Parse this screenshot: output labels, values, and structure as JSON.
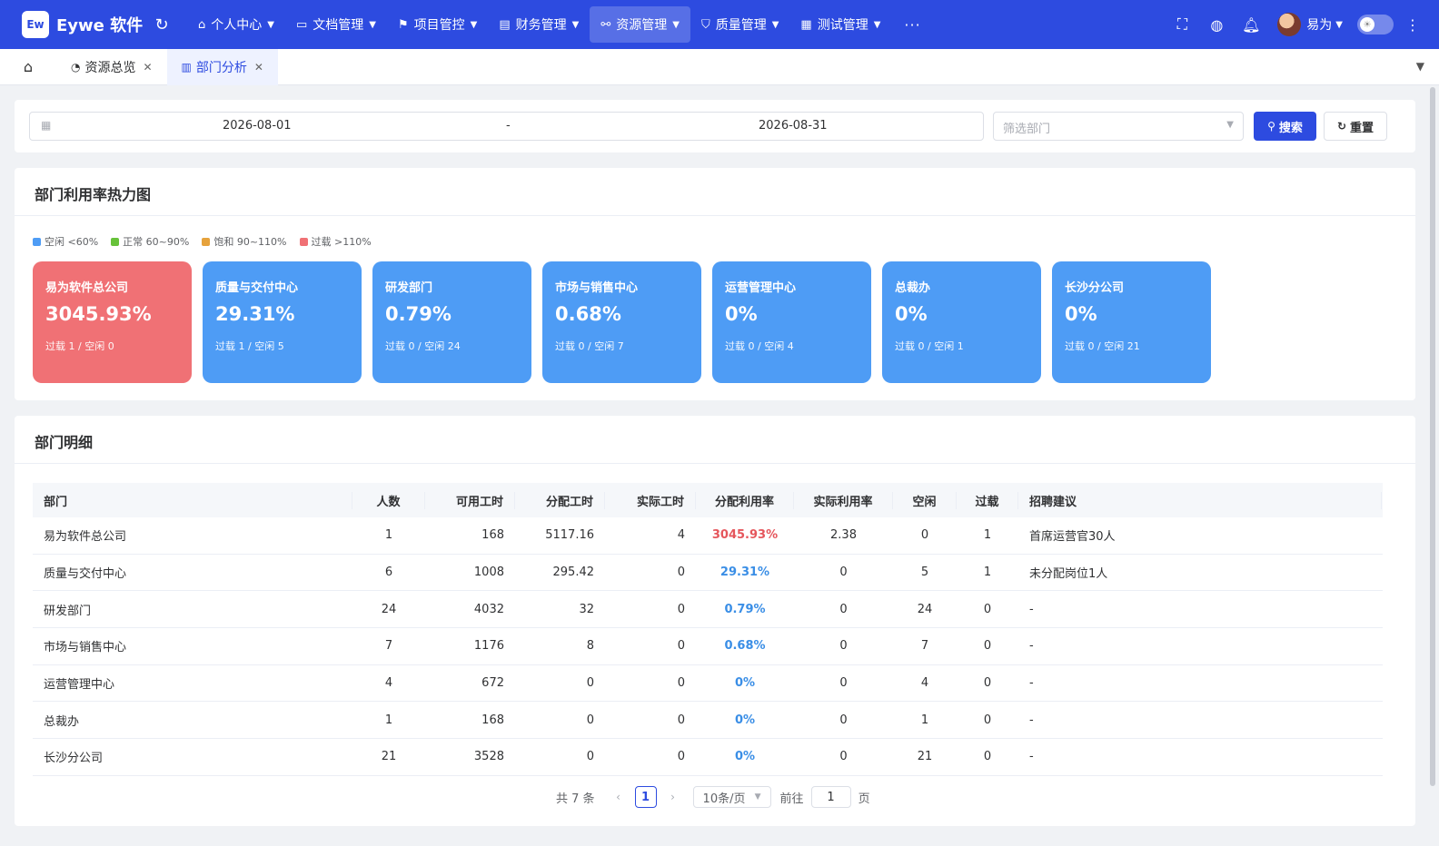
{
  "brand": {
    "logo": "Ew",
    "name": "Eywe 软件"
  },
  "nav": {
    "items": [
      {
        "icon": "⌂",
        "label": "个人中心",
        "active": false
      },
      {
        "icon": "▭",
        "label": "文档管理",
        "active": false
      },
      {
        "icon": "⚑",
        "label": "项目管控",
        "active": false
      },
      {
        "icon": "▤",
        "label": "财务管理",
        "active": false
      },
      {
        "icon": "⚯",
        "label": "资源管理",
        "active": true
      },
      {
        "icon": "⛉",
        "label": "质量管理",
        "active": false
      },
      {
        "icon": "▦",
        "label": "测试管理",
        "active": false
      }
    ],
    "more": "···"
  },
  "user": {
    "name": "易为"
  },
  "tabs": [
    {
      "icon": "◔",
      "label": "资源总览",
      "active": false
    },
    {
      "icon": "▥",
      "label": "部门分析",
      "active": true
    }
  ],
  "filter": {
    "start_date": "2026-08-01",
    "separator": "-",
    "end_date": "2026-08-31",
    "dept_placeholder": "筛选部门",
    "search_label": "搜索",
    "reset_label": "重置"
  },
  "heatmap": {
    "title": "部门利用率热力图",
    "legend": [
      {
        "label": "空闲 <60%",
        "color": "#4e9cf5"
      },
      {
        "label": "正常 60~90%",
        "color": "#67c23a"
      },
      {
        "label": "饱和 90~110%",
        "color": "#e6a23c"
      },
      {
        "label": "过载 >110%",
        "color": "#f07175"
      }
    ],
    "tiles": [
      {
        "name": "易为软件总公司",
        "value": "3045.93%",
        "sub": "过载 1 / 空闲 0",
        "color": "#f07175"
      },
      {
        "name": "质量与交付中心",
        "value": "29.31%",
        "sub": "过载 1 / 空闲 5",
        "color": "#4e9cf5"
      },
      {
        "name": "研发部门",
        "value": "0.79%",
        "sub": "过载 0 / 空闲 24",
        "color": "#4e9cf5"
      },
      {
        "name": "市场与销售中心",
        "value": "0.68%",
        "sub": "过载 0 / 空闲 7",
        "color": "#4e9cf5"
      },
      {
        "name": "运营管理中心",
        "value": "0%",
        "sub": "过载 0 / 空闲 4",
        "color": "#4e9cf5"
      },
      {
        "name": "总裁办",
        "value": "0%",
        "sub": "过载 0 / 空闲 1",
        "color": "#4e9cf5"
      },
      {
        "name": "长沙分公司",
        "value": "0%",
        "sub": "过载 0 / 空闲 21",
        "color": "#4e9cf5"
      }
    ]
  },
  "detail": {
    "title": "部门明细",
    "columns": [
      "部门",
      "人数",
      "可用工时",
      "分配工时",
      "实际工时",
      "分配利用率",
      "实际利用率",
      "空闲",
      "过载",
      "招聘建议"
    ],
    "rows": [
      [
        "易为软件总公司",
        "1",
        "168",
        "5117.16",
        "4",
        "3045.93%",
        "2.38",
        "0",
        "1",
        "首席运营官30人"
      ],
      [
        "质量与交付中心",
        "6",
        "1008",
        "295.42",
        "0",
        "29.31%",
        "0",
        "5",
        "1",
        "未分配岗位1人"
      ],
      [
        "研发部门",
        "24",
        "4032",
        "32",
        "0",
        "0.79%",
        "0",
        "24",
        "0",
        "-"
      ],
      [
        "市场与销售中心",
        "7",
        "1176",
        "8",
        "0",
        "0.68%",
        "0",
        "7",
        "0",
        "-"
      ],
      [
        "运营管理中心",
        "4",
        "672",
        "0",
        "0",
        "0%",
        "0",
        "4",
        "0",
        "-"
      ],
      [
        "总裁办",
        "1",
        "168",
        "0",
        "0",
        "0%",
        "0",
        "1",
        "0",
        "-"
      ],
      [
        "长沙分公司",
        "21",
        "3528",
        "0",
        "0",
        "0%",
        "0",
        "21",
        "0",
        "-"
      ]
    ],
    "rate_colors": [
      "#e5565c",
      "#3a8ee6",
      "#3a8ee6",
      "#3a8ee6",
      "#3a8ee6",
      "#3a8ee6",
      "#3a8ee6"
    ]
  },
  "pagination": {
    "total": "共 7 条",
    "current": "1",
    "page_size": "10条/页",
    "goto_prefix": "前往",
    "goto_value": "1",
    "goto_suffix": "页"
  },
  "colors": {
    "primary": "#2d4be0",
    "overload": "#f07175",
    "idle": "#4e9cf5"
  }
}
